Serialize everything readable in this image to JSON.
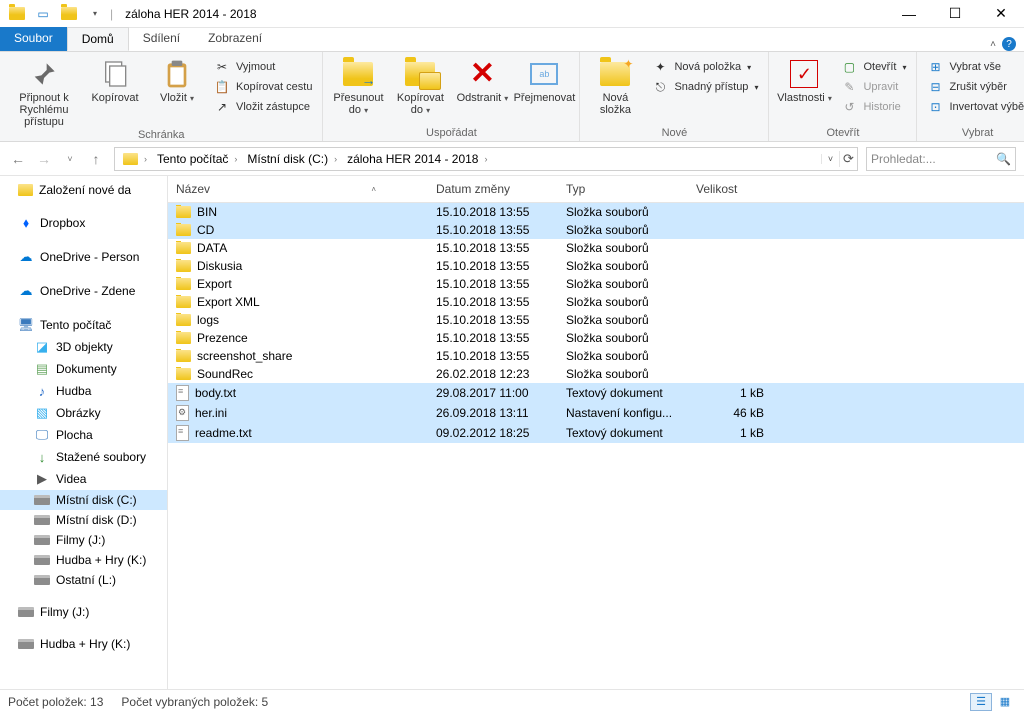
{
  "window": {
    "title": "záloha HER 2014 - 2018"
  },
  "tabs": {
    "file": "Soubor",
    "home": "Domů",
    "share": "Sdílení",
    "view": "Zobrazení"
  },
  "ribbon": {
    "clipboard": {
      "label": "Schránka",
      "pin": "Připnout k Rychlému přístupu",
      "copy": "Kopírovat",
      "paste": "Vložit",
      "cut": "Vyjmout",
      "copy_path": "Kopírovat cestu",
      "paste_shortcut": "Vložit zástupce"
    },
    "organize": {
      "label": "Uspořádat",
      "move_to": "Přesunout do",
      "copy_to": "Kopírovat do",
      "delete": "Odstranit",
      "rename": "Přejmenovat"
    },
    "new": {
      "label": "Nové",
      "new_folder": "Nová složka",
      "new_item": "Nová položka",
      "easy_access": "Snadný přístup"
    },
    "open": {
      "label": "Otevřít",
      "properties": "Vlastnosti",
      "open": "Otevřít",
      "edit": "Upravit",
      "history": "Historie"
    },
    "select": {
      "label": "Vybrat",
      "select_all": "Vybrat vše",
      "select_none": "Zrušit výběr",
      "invert": "Invertovat výběr"
    }
  },
  "address": {
    "crumbs": [
      "Tento počítač",
      "Místní disk (C:)",
      "záloha HER 2014 - 2018"
    ]
  },
  "search": {
    "placeholder": "Prohledat:..."
  },
  "tree": {
    "quick1": "Založení nové da",
    "dropbox": "Dropbox",
    "onedrive_p": "OneDrive - Person",
    "onedrive_z": "OneDrive - Zdene",
    "this_pc": "Tento počítač",
    "3d": "3D objekty",
    "docs": "Dokumenty",
    "music": "Hudba",
    "pics": "Obrázky",
    "desktop": "Plocha",
    "downloads": "Stažené soubory",
    "videos": "Videa",
    "disk_c": "Místní disk (C:)",
    "disk_d": "Místní disk (D:)",
    "disk_j": "Filmy (J:)",
    "disk_k": "Hudba + Hry (K:)",
    "disk_l": "Ostatní (L:)",
    "disk_j2": "Filmy (J:)",
    "disk_k2": "Hudba + Hry (K:)"
  },
  "columns": {
    "name": "Název",
    "date": "Datum změny",
    "type": "Typ",
    "size": "Velikost"
  },
  "files": [
    {
      "name": "BIN",
      "date": "15.10.2018 13:55",
      "type": "Složka souborů",
      "size": "",
      "kind": "folder",
      "sel": true
    },
    {
      "name": "CD",
      "date": "15.10.2018 13:55",
      "type": "Složka souborů",
      "size": "",
      "kind": "folder",
      "sel": true
    },
    {
      "name": "DATA",
      "date": "15.10.2018 13:55",
      "type": "Složka souborů",
      "size": "",
      "kind": "folder",
      "sel": false
    },
    {
      "name": "Diskusia",
      "date": "15.10.2018 13:55",
      "type": "Složka souborů",
      "size": "",
      "kind": "folder",
      "sel": false
    },
    {
      "name": "Export",
      "date": "15.10.2018 13:55",
      "type": "Složka souborů",
      "size": "",
      "kind": "folder",
      "sel": false
    },
    {
      "name": "Export XML",
      "date": "15.10.2018 13:55",
      "type": "Složka souborů",
      "size": "",
      "kind": "folder",
      "sel": false
    },
    {
      "name": "logs",
      "date": "15.10.2018 13:55",
      "type": "Složka souborů",
      "size": "",
      "kind": "folder",
      "sel": false
    },
    {
      "name": "Prezence",
      "date": "15.10.2018 13:55",
      "type": "Složka souborů",
      "size": "",
      "kind": "folder",
      "sel": false
    },
    {
      "name": "screenshot_share",
      "date": "15.10.2018 13:55",
      "type": "Složka souborů",
      "size": "",
      "kind": "folder",
      "sel": false
    },
    {
      "name": "SoundRec",
      "date": "26.02.2018 12:23",
      "type": "Složka souborů",
      "size": "",
      "kind": "folder",
      "sel": false
    },
    {
      "name": "body.txt",
      "date": "29.08.2017 11:00",
      "type": "Textový dokument",
      "size": "1 kB",
      "kind": "txt",
      "sel": true
    },
    {
      "name": "her.ini",
      "date": "26.09.2018 13:11",
      "type": "Nastavení konfigu...",
      "size": "46 kB",
      "kind": "ini",
      "sel": true
    },
    {
      "name": "readme.txt",
      "date": "09.02.2012 18:25",
      "type": "Textový dokument",
      "size": "1 kB",
      "kind": "txt",
      "sel": true
    }
  ],
  "status": {
    "count": "Počet položek: 13",
    "selected": "Počet vybraných položek: 5"
  }
}
